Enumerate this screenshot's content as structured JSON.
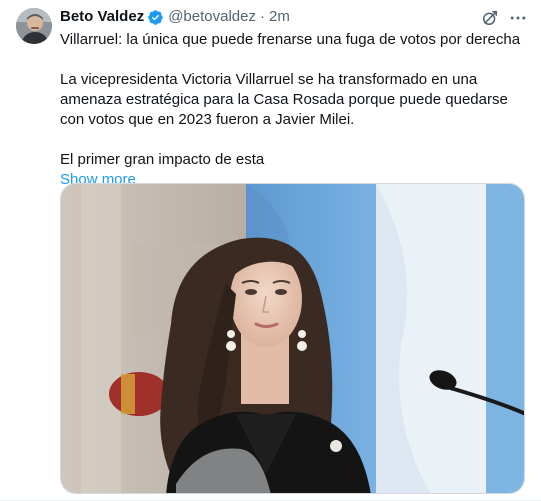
{
  "tweet": {
    "author": {
      "display_name": "Beto Valdez",
      "handle": "@betovaldez",
      "separator": "·",
      "time": "2m",
      "verified": true
    },
    "paragraphs": [
      "Villarruel: la única que puede frenarse una fuga de votos por derecha",
      "La vicepresidenta Victoria Villarruel se ha transformado en una amenaza estratégica para la Casa Rosada porque puede quedarse con votos que en 2023 fueron a Javier Milei.",
      "El primer gran impacto de esta"
    ],
    "show_more_label": "Show more",
    "icons": {
      "verified": "verified-badge-icon",
      "grok": "grok-icon",
      "more": "more-options-icon"
    }
  },
  "colors": {
    "accent": "#1d9bf0",
    "text_primary": "#0f1419",
    "text_secondary": "#536471",
    "flag_blue": "#74acdf"
  }
}
